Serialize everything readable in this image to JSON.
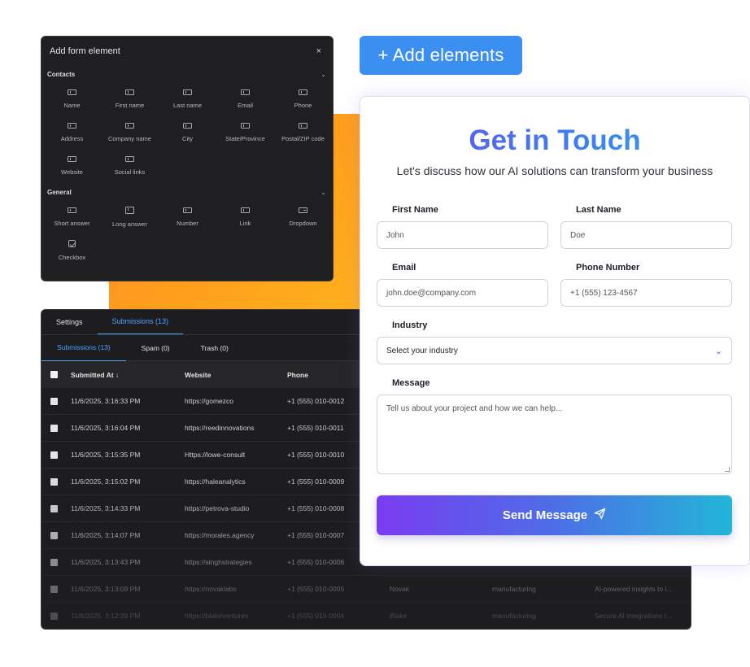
{
  "add_panel": {
    "title": "Add form element",
    "close": "×",
    "contacts": {
      "title": "Contacts",
      "items": [
        "Name",
        "First name",
        "Last name",
        "Email",
        "Phone",
        "Address",
        "Company name",
        "City",
        "State/Province",
        "Postal/ZIP code",
        "Website",
        "Social links"
      ]
    },
    "general": {
      "title": "General",
      "items": [
        "Short answer",
        "Long answer",
        "Number",
        "Link",
        "Dropdown",
        "Checkbox"
      ]
    }
  },
  "add_elements_button": "+ Add elements",
  "submissions": {
    "top_tabs": [
      "Settings",
      "Submissions (13)"
    ],
    "sub_tabs": [
      "Submissions (13)",
      "Spam (0)",
      "Trash (0)"
    ],
    "columns": [
      "Submitted At ↓",
      "Website",
      "Phone"
    ],
    "rows": [
      {
        "date": "11/6/2025, 3:16:33 PM",
        "website": "https://gomezco",
        "phone": "+1 (555) 010-0012",
        "last": "",
        "industry": "",
        "message": ""
      },
      {
        "date": "11/6/2025, 3:16:04 PM",
        "website": "https://reedinnovations",
        "phone": "+1 (555) 010-0011",
        "last": "",
        "industry": "",
        "message": ""
      },
      {
        "date": "11/6/2025, 3:15:35 PM",
        "website": "Https://lowe-consult",
        "phone": "+1 (555) 010-0010",
        "last": "",
        "industry": "",
        "message": ""
      },
      {
        "date": "11/6/2025, 3:15:02 PM",
        "website": "https://haleanalytics",
        "phone": "+1 (555) 010-0009",
        "last": "",
        "industry": "",
        "message": ""
      },
      {
        "date": "11/6/2025, 3:14:33 PM",
        "website": "https://petrova-studio",
        "phone": "+1 (555) 010-0008",
        "last": "",
        "industry": "",
        "message": ""
      },
      {
        "date": "11/6/2025, 3:14:07 PM",
        "website": "https://morales.agency",
        "phone": "+1 (555) 010-0007",
        "last": "",
        "industry": "",
        "message": ""
      },
      {
        "date": "11/6/2025, 3:13:43 PM",
        "website": "https://singhstrategies",
        "phone": "+1 (555) 010-0006",
        "last": "",
        "industry": "",
        "message": ""
      },
      {
        "date": "11/6/2025, 3:13:09 PM",
        "website": "https://novaklabs",
        "phone": "+1 (555) 010-0005",
        "last": "Novak",
        "industry": "manufacturing",
        "message": "AI-powered insights to i..."
      },
      {
        "date": "11/6/2025, 3:12:39 PM",
        "website": "https://blakeventures",
        "phone": "+1 (555) 010-0004",
        "last": "Blake",
        "industry": "manufacturing",
        "message": "Secure AI integrations t..."
      }
    ]
  },
  "form": {
    "title": "Get in Touch",
    "subtitle": "Let's discuss how our AI solutions can transform your business",
    "first_name": {
      "label": "First Name",
      "placeholder": "John"
    },
    "last_name": {
      "label": "Last Name",
      "placeholder": "Doe"
    },
    "email": {
      "label": "Email",
      "placeholder": "john.doe@company.com"
    },
    "phone": {
      "label": "Phone Number",
      "placeholder": "+1 (555) 123-4567"
    },
    "industry": {
      "label": "Industry",
      "value": "Select your industry"
    },
    "message": {
      "label": "Message",
      "placeholder": "Tell us about your project and how we can help..."
    },
    "send": "Send Message"
  },
  "colors": {
    "accent_blue": "#3b8ff0",
    "tab_active": "#4da3ff",
    "orange": "#ff9f1c",
    "gradient_start": "#7a3cf2",
    "gradient_end": "#22b6d8"
  },
  "icons": {
    "field": "input-field-icon",
    "checkbox": "checkbox-icon",
    "send": "paper-plane-icon",
    "chevron": "chevron-down-icon"
  }
}
